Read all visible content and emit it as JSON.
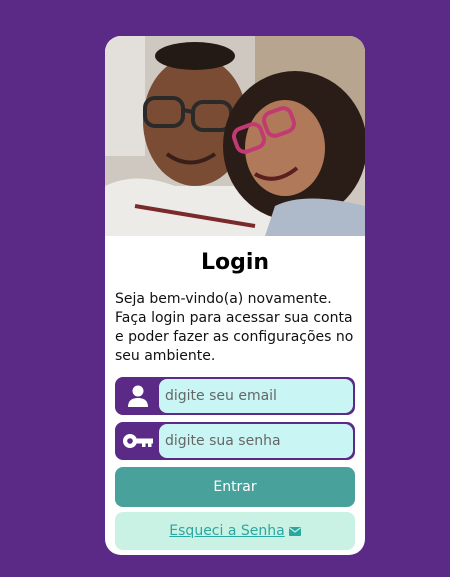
{
  "login": {
    "title": "Login",
    "welcome_text": "Seja bem-vindo(a) novamente. Faça login para acessar sua conta e poder fazer as configurações no seu ambiente.",
    "email_placeholder": "digite seu email",
    "email_value": "",
    "password_placeholder": "digite sua senha",
    "password_value": "",
    "submit_label": "Entrar",
    "forgot_label": "Esqueci a Senha"
  },
  "icons": {
    "email_field": "user-icon",
    "password_field": "key-icon",
    "forgot_link": "envelope-icon"
  },
  "colors": {
    "background": "#5b2a86",
    "card": "#ffffff",
    "input_fill": "#c9f6f4",
    "primary_button": "#48a19a",
    "secondary_button": "#c9f2e4",
    "link": "#2aa7a0"
  }
}
